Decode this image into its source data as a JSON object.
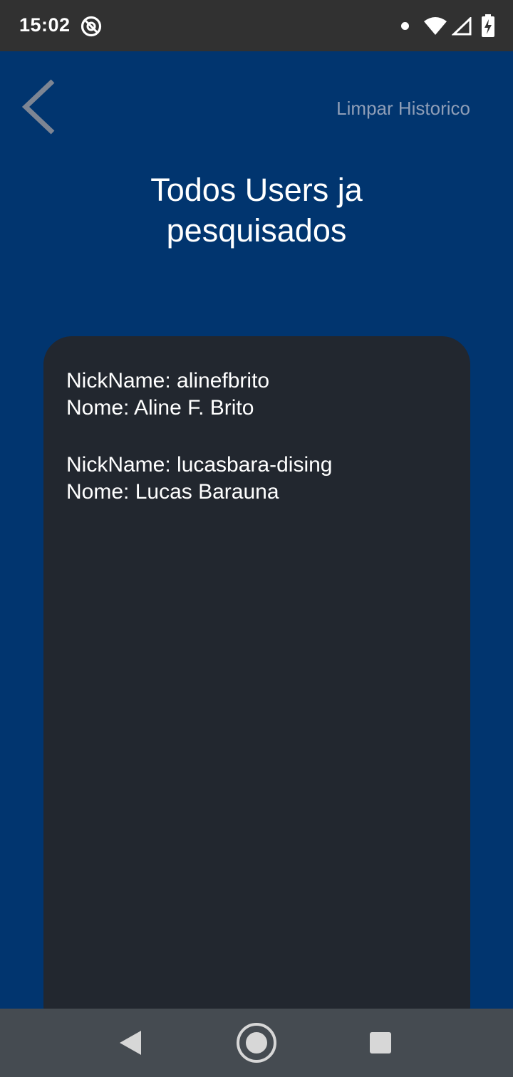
{
  "status_bar": {
    "time": "15:02",
    "icons": [
      "at-sign-icon",
      "notification-dot-icon",
      "wifi-icon",
      "signal-icon",
      "battery-charging-icon"
    ]
  },
  "header": {
    "back_icon": "chevron-left-icon",
    "clear_history_label": "Limpar Historico",
    "title_line1": "Todos Users ja",
    "title_line2": "pesquisados"
  },
  "history": {
    "entries": [
      {
        "nickname": "NickName: alinefbrito",
        "name": "Nome: Aline F. Brito"
      },
      {
        "nickname": "NickName: lucasbara-dising",
        "name": "Nome: Lucas Barauna"
      }
    ]
  },
  "nav_bar": {
    "icons": [
      "nav-back-icon",
      "nav-home-icon",
      "nav-recents-icon"
    ]
  },
  "colors": {
    "background": "#01356f",
    "status_bar": "#313131",
    "card": "#22272f",
    "nav_bar": "#454b51",
    "muted_text": "#8f9eb7"
  }
}
